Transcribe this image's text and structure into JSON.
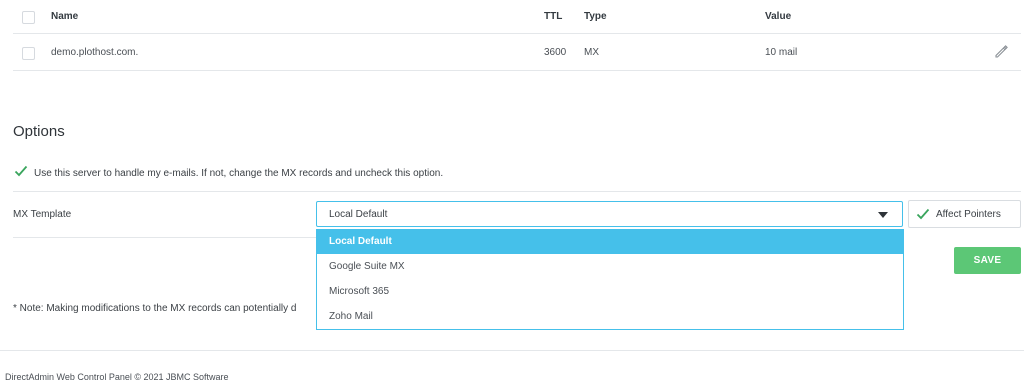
{
  "table": {
    "headers": {
      "name": "Name",
      "ttl": "TTL",
      "type": "Type",
      "value": "Value"
    },
    "rows": [
      {
        "name": "demo.plothost.com.",
        "ttl": "3600",
        "type": "MX",
        "value": "10 mail"
      }
    ]
  },
  "options": {
    "title": "Options",
    "use_server_label": "Use this server to handle my e-mails. If not, change the MX records and uncheck this option.",
    "use_server_checked": true,
    "mx_template_label": "MX Template",
    "mx_selected": "Local Default",
    "mx_options": [
      "Local Default",
      "Google Suite MX",
      "Microsoft 365",
      "Zoho Mail"
    ],
    "affect_pointers_label": "Affect Pointers",
    "affect_pointers_checked": true,
    "save_label": "SAVE",
    "note": "* Note: Making modifications to the MX records can potentially d"
  },
  "footer": {
    "text": "DirectAdmin Web Control Panel © 2021 JBMC Software"
  },
  "colors": {
    "accent": "#45c0ea",
    "save": "#5cc776",
    "check": "#3aa55d"
  },
  "icons": {
    "edit": "pencil-icon",
    "check": "checkmark-icon",
    "caret": "caret-down-icon"
  }
}
